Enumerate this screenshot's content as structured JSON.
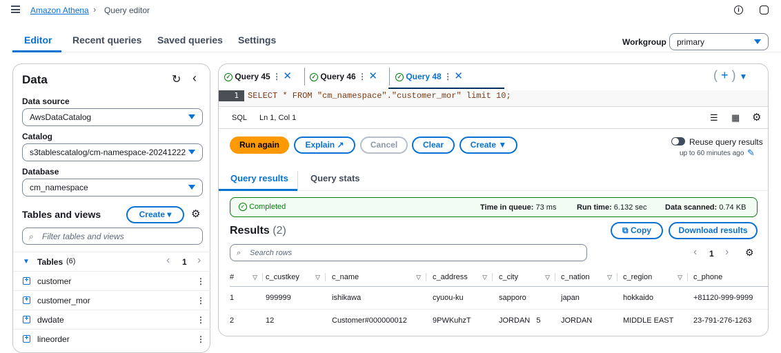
{
  "breadcrumb": {
    "service": "Amazon Athena",
    "page": "Query editor"
  },
  "main_tabs": [
    "Editor",
    "Recent queries",
    "Saved queries",
    "Settings"
  ],
  "workgroup": {
    "label": "Workgroup",
    "value": "primary"
  },
  "data_panel": {
    "title": "Data",
    "data_source_label": "Data source",
    "data_source": "AwsDataCatalog",
    "catalog_label": "Catalog",
    "catalog": "s3tablescatalog/cm-namespace-20241222",
    "database_label": "Database",
    "database": "cm_namespace",
    "tables_views_title": "Tables and views",
    "create_label": "Create",
    "filter_placeholder": "Filter tables and views",
    "tables_label": "Tables",
    "tables_count": "(6)",
    "page": "1",
    "tables": [
      "customer",
      "customer_mor",
      "dwdate",
      "lineorder"
    ]
  },
  "query_tabs": [
    {
      "label": "Query 45"
    },
    {
      "label": "Query 46"
    },
    {
      "label": "Query 48",
      "active": true
    }
  ],
  "editor": {
    "line": "1",
    "sql": "SELECT * FROM \"cm_namespace\".\"customer_mor\" limit 10;",
    "lang": "SQL",
    "position": "Ln 1, Col 1"
  },
  "actions": {
    "run": "Run again",
    "explain": "Explain",
    "cancel": "Cancel",
    "clear": "Clear",
    "create": "Create",
    "reuse": "Reuse query results",
    "reuse_sub": "up to 60 minutes ago"
  },
  "result_tabs": [
    "Query results",
    "Query stats"
  ],
  "status": {
    "state": "Completed",
    "queue_label": "Time in queue:",
    "queue": "73 ms",
    "run_label": "Run time:",
    "run": "6.132 sec",
    "scanned_label": "Data scanned:",
    "scanned": "0.74 KB"
  },
  "results": {
    "title": "Results",
    "count": "(2)",
    "copy": "Copy",
    "download": "Download results",
    "search_placeholder": "Search rows",
    "page": "1",
    "columns": [
      "#",
      "c_custkey",
      "c_name",
      "c_address",
      "c_city",
      "c_nation",
      "c_region",
      "c_phone"
    ],
    "rows": [
      [
        "1",
        "999999",
        "ishikawa",
        "cyuou-ku",
        "sapporo",
        "japan",
        "hokkaido",
        "+81120-999-9999"
      ],
      [
        "2",
        "12",
        "Customer#000000012",
        "9PWKuhzT",
        "JORDAN   5",
        "JORDAN",
        "MIDDLE EAST",
        "23-791-276-1263"
      ]
    ]
  },
  "colors": {
    "accent": "#0972d3",
    "run": "#ff9900",
    "success": "#037f0c"
  }
}
